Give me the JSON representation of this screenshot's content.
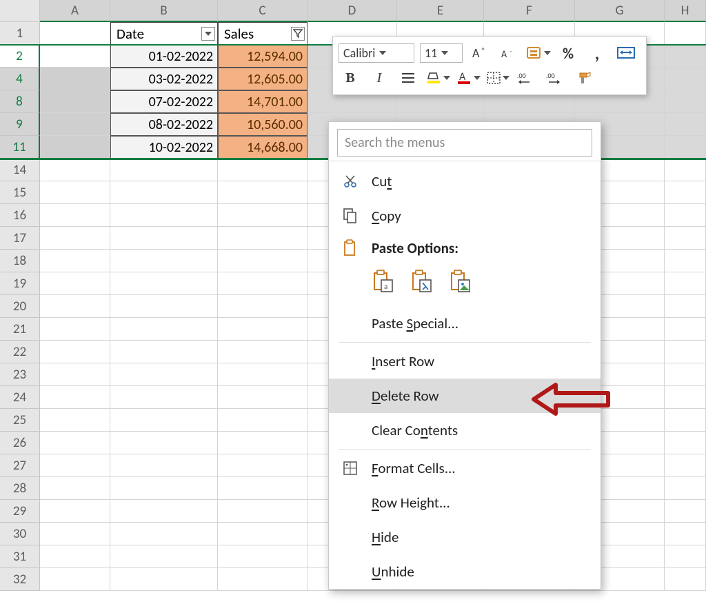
{
  "columns": [
    "A",
    "B",
    "C",
    "D",
    "E",
    "F",
    "G",
    "H"
  ],
  "row_numbers": [
    1,
    2,
    4,
    8,
    9,
    11,
    14,
    15,
    16,
    17,
    18,
    19,
    20,
    21,
    22,
    23,
    24,
    25,
    26,
    27,
    28,
    29,
    30,
    31,
    32
  ],
  "selected_rows": [
    2,
    4,
    8,
    9,
    11
  ],
  "active_row": 2,
  "table": {
    "headers": {
      "date": "Date",
      "sales": "Sales"
    },
    "rows": [
      {
        "date": "01-02-2022",
        "sales": "12,594.00"
      },
      {
        "date": "03-02-2022",
        "sales": "12,605.00"
      },
      {
        "date": "07-02-2022",
        "sales": "14,701.00"
      },
      {
        "date": "08-02-2022",
        "sales": "10,560.00"
      },
      {
        "date": "10-02-2022",
        "sales": "14,668.00"
      }
    ]
  },
  "mini_toolbar": {
    "font_name": "Calibri",
    "font_size": "11"
  },
  "context_menu": {
    "search_placeholder": "Search the menus",
    "cut": "Cut",
    "copy": "Copy",
    "paste_options": "Paste Options:",
    "paste_special": "Paste Special...",
    "insert_row": "Insert Row",
    "delete_row": "Delete Row",
    "clear_contents": "Clear Contents",
    "format_cells": "Format Cells...",
    "row_height": "Row Height...",
    "hide": "Hide",
    "unhide": "Unhide"
  },
  "chart_data": {
    "type": "table",
    "columns": [
      "Date",
      "Sales"
    ],
    "rows": [
      [
        "01-02-2022",
        12594.0
      ],
      [
        "03-02-2022",
        12605.0
      ],
      [
        "07-02-2022",
        14701.0
      ],
      [
        "08-02-2022",
        10560.0
      ],
      [
        "10-02-2022",
        14668.0
      ]
    ]
  }
}
